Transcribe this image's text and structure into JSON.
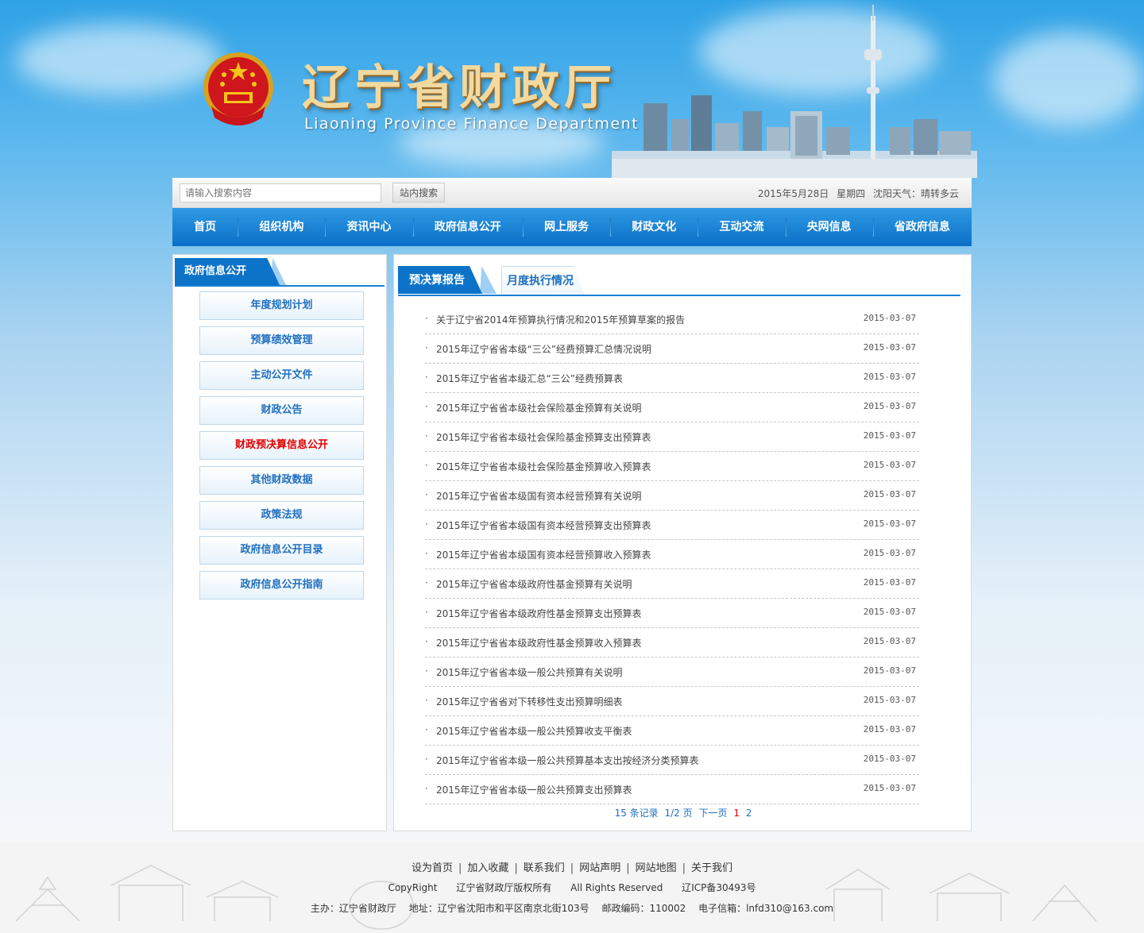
{
  "header": {
    "title": "辽宁省财政厅",
    "subtitle": "Liaoning Province Finance Department"
  },
  "topbar": {
    "search_placeholder": "请输入搜索内容",
    "search_button": "站内搜索",
    "date": "2015年5月28日",
    "weekday": "星期四",
    "weather": "沈阳天气：晴转多云"
  },
  "nav": {
    "items": [
      "首页",
      "组织机构",
      "资讯中心",
      "政府信息公开",
      "网上服务",
      "财政文化",
      "互动交流",
      "央网信息",
      "省政府信息"
    ]
  },
  "sidebar": {
    "title": "政府信息公开",
    "items": [
      {
        "label": "年度规划计划",
        "active": false
      },
      {
        "label": "预算绩效管理",
        "active": false
      },
      {
        "label": "主动公开文件",
        "active": false
      },
      {
        "label": "财政公告",
        "active": false
      },
      {
        "label": "财政预决算信息公开",
        "active": true
      },
      {
        "label": "其他财政数据",
        "active": false
      },
      {
        "label": "政策法规",
        "active": false
      },
      {
        "label": "政府信息公开目录",
        "active": false
      },
      {
        "label": "政府信息公开指南",
        "active": false
      }
    ]
  },
  "main": {
    "tabs": [
      {
        "label": "预决算报告",
        "active": true
      },
      {
        "label": "月度执行情况",
        "active": false
      }
    ],
    "bullet": "·",
    "articles": [
      {
        "title": "关于辽宁省2014年预算执行情况和2015年预算草案的报告",
        "date": "2015-03-07"
      },
      {
        "title": "2015年辽宁省省本级“三公”经费预算汇总情况说明",
        "date": "2015-03-07"
      },
      {
        "title": "2015年辽宁省省本级汇总“三公”经费预算表",
        "date": "2015-03-07"
      },
      {
        "title": "2015年辽宁省省本级社会保险基金预算有关说明",
        "date": "2015-03-07"
      },
      {
        "title": "2015年辽宁省省本级社会保险基金预算支出预算表",
        "date": "2015-03-07"
      },
      {
        "title": "2015年辽宁省省本级社会保险基金预算收入预算表",
        "date": "2015-03-07"
      },
      {
        "title": "2015年辽宁省省本级国有资本经营预算有关说明",
        "date": "2015-03-07"
      },
      {
        "title": "2015年辽宁省省本级国有资本经营预算支出预算表",
        "date": "2015-03-07"
      },
      {
        "title": "2015年辽宁省省本级国有资本经营预算收入预算表",
        "date": "2015-03-07"
      },
      {
        "title": "2015年辽宁省省本级政府性基金预算有关说明",
        "date": "2015-03-07"
      },
      {
        "title": "2015年辽宁省省本级政府性基金预算支出预算表",
        "date": "2015-03-07"
      },
      {
        "title": "2015年辽宁省省本级政府性基金预算收入预算表",
        "date": "2015-03-07"
      },
      {
        "title": "2015年辽宁省省本级一般公共预算有关说明",
        "date": "2015-03-07"
      },
      {
        "title": "2015年辽宁省省对下转移性支出预算明细表",
        "date": "2015-03-07"
      },
      {
        "title": "2015年辽宁省省本级一般公共预算收支平衡表",
        "date": "2015-03-07"
      },
      {
        "title": "2015年辽宁省省本级一般公共预算基本支出按经济分类预算表",
        "date": "2015-03-07"
      },
      {
        "title": "2015年辽宁省省本级一般公共预算支出预算表",
        "date": "2015-03-07"
      }
    ],
    "pager": {
      "records": "15 条记录",
      "pages": "1/2 页",
      "next": "下一页",
      "current": "1",
      "page2": "2"
    }
  },
  "footer": {
    "links": [
      "设为首页",
      "加入收藏",
      "联系我们",
      "网站声明",
      "网站地图",
      "关于我们"
    ],
    "separator": "|",
    "copyright_label": "CopyRight",
    "copyright_owner": "辽宁省财政厅版权所有",
    "rights": "All Rights Reserved",
    "icp": "辽ICP备30493号",
    "host": "主办：辽宁省财政厅",
    "address": "地址：辽宁省沈阳市和平区南京北街103号",
    "postcode": "邮政编码：110002",
    "email": "电子信箱：lnfd310@163.com"
  },
  "colors": {
    "nav_blue": "#0b6fc7",
    "accent_blue": "#1f6fbf",
    "active_red": "#e00000"
  }
}
